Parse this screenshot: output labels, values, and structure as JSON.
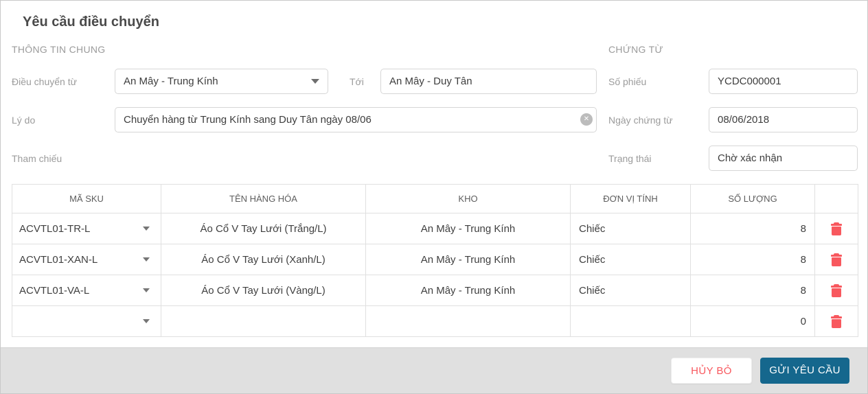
{
  "page": {
    "title": "Yêu cầu điều chuyển"
  },
  "sections": {
    "general": "THÔNG TIN CHUNG",
    "document": "CHỨNG TỪ"
  },
  "fields": {
    "transfer_from": {
      "label": "Điều chuyển từ",
      "value": "An Mây - Trung Kính"
    },
    "to": {
      "label": "Tới",
      "value": "An Mây - Duy Tân"
    },
    "receipt_number": {
      "label": "Số phiếu",
      "value": "YCDC000001"
    },
    "reason": {
      "label": "Lý do",
      "value": "Chuyển hàng từ Trung Kính sang Duy Tân ngày 08/06"
    },
    "document_date": {
      "label": "Ngày chứng từ",
      "value": "08/06/2018"
    },
    "reference": {
      "label": "Tham chiếu",
      "value": ""
    },
    "status": {
      "label": "Trạng thái",
      "value": "Chờ xác nhận"
    }
  },
  "table": {
    "headers": {
      "sku": "MÃ SKU",
      "name": "TÊN HÀNG HÓA",
      "warehouse": "KHO",
      "unit": "ĐƠN VỊ TÍNH",
      "quantity": "SỐ LƯỢNG",
      "action": ""
    },
    "rows": [
      {
        "sku": "ACVTL01-TR-L",
        "name": "Áo Cổ V Tay Lưới (Trắng/L)",
        "warehouse": "An Mây - Trung Kính",
        "unit": "Chiếc",
        "quantity": "8"
      },
      {
        "sku": "ACVTL01-XAN-L",
        "name": "Áo Cổ V Tay Lưới (Xanh/L)",
        "warehouse": "An Mây - Trung Kính",
        "unit": "Chiếc",
        "quantity": "8"
      },
      {
        "sku": "ACVTL01-VA-L",
        "name": "Áo Cổ V Tay Lưới (Vàng/L)",
        "warehouse": "An Mây - Trung Kính",
        "unit": "Chiếc",
        "quantity": "8"
      },
      {
        "sku": "",
        "name": "",
        "warehouse": "",
        "unit": "",
        "quantity": "0"
      }
    ]
  },
  "footer": {
    "cancel_label": "HỦY BỎ",
    "submit_label": "GỬI YÊU CẦU"
  },
  "icons": {
    "clear": "x-circle",
    "dropdown": "chevron-down",
    "delete": "trash"
  },
  "colors": {
    "accent_blue": "#15678d",
    "danger_red": "#f8585e",
    "footer_bg": "#e0e0e0"
  }
}
